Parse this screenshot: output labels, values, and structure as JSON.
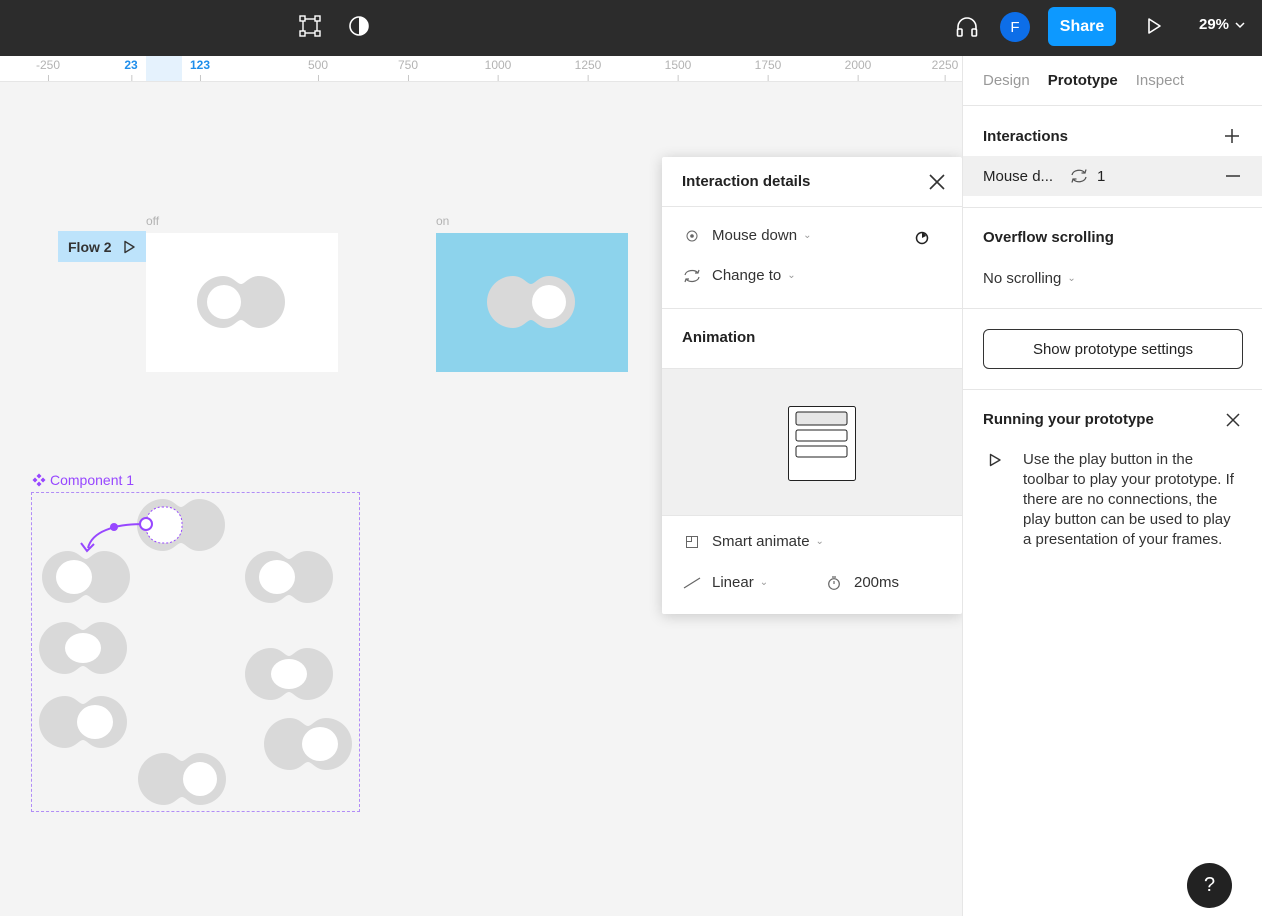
{
  "toolbar": {
    "avatar_initial": "F",
    "share_label": "Share",
    "zoom_label": "29%"
  },
  "ruler": {
    "ticks": [
      "-250",
      "23",
      "123",
      "500",
      "750",
      "1000",
      "1250",
      "1500",
      "1750",
      "2000",
      "2250"
    ],
    "highlighted": [
      "23",
      "123"
    ]
  },
  "canvas": {
    "frame_off_label": "off",
    "frame_on_label": "on",
    "flow_label": "Flow 2",
    "component_label": "Component 1",
    "colors": {
      "on_frame": "#8dd3ec",
      "component_accent": "#9747ff",
      "toggle_track": "#d9d9d9"
    }
  },
  "interaction_details": {
    "title": "Interaction details",
    "trigger": "Mouse down",
    "action": "Change to",
    "animation_title": "Animation",
    "animation_type": "Smart animate",
    "easing": "Linear",
    "duration": "200ms"
  },
  "panel": {
    "tabs": [
      "Design",
      "Prototype",
      "Inspect"
    ],
    "active_tab": "Prototype",
    "interactions_title": "Interactions",
    "interaction_item": {
      "label": "Mouse d...",
      "count": "1"
    },
    "overflow_title": "Overflow scrolling",
    "overflow_value": "No scrolling",
    "prototype_settings_button": "Show prototype settings",
    "running_title": "Running your prototype",
    "running_text": "Use the play button in the toolbar to play your prototype. If there are no connections, the play button can be used to play a presentation of your frames."
  },
  "help_label": "?"
}
